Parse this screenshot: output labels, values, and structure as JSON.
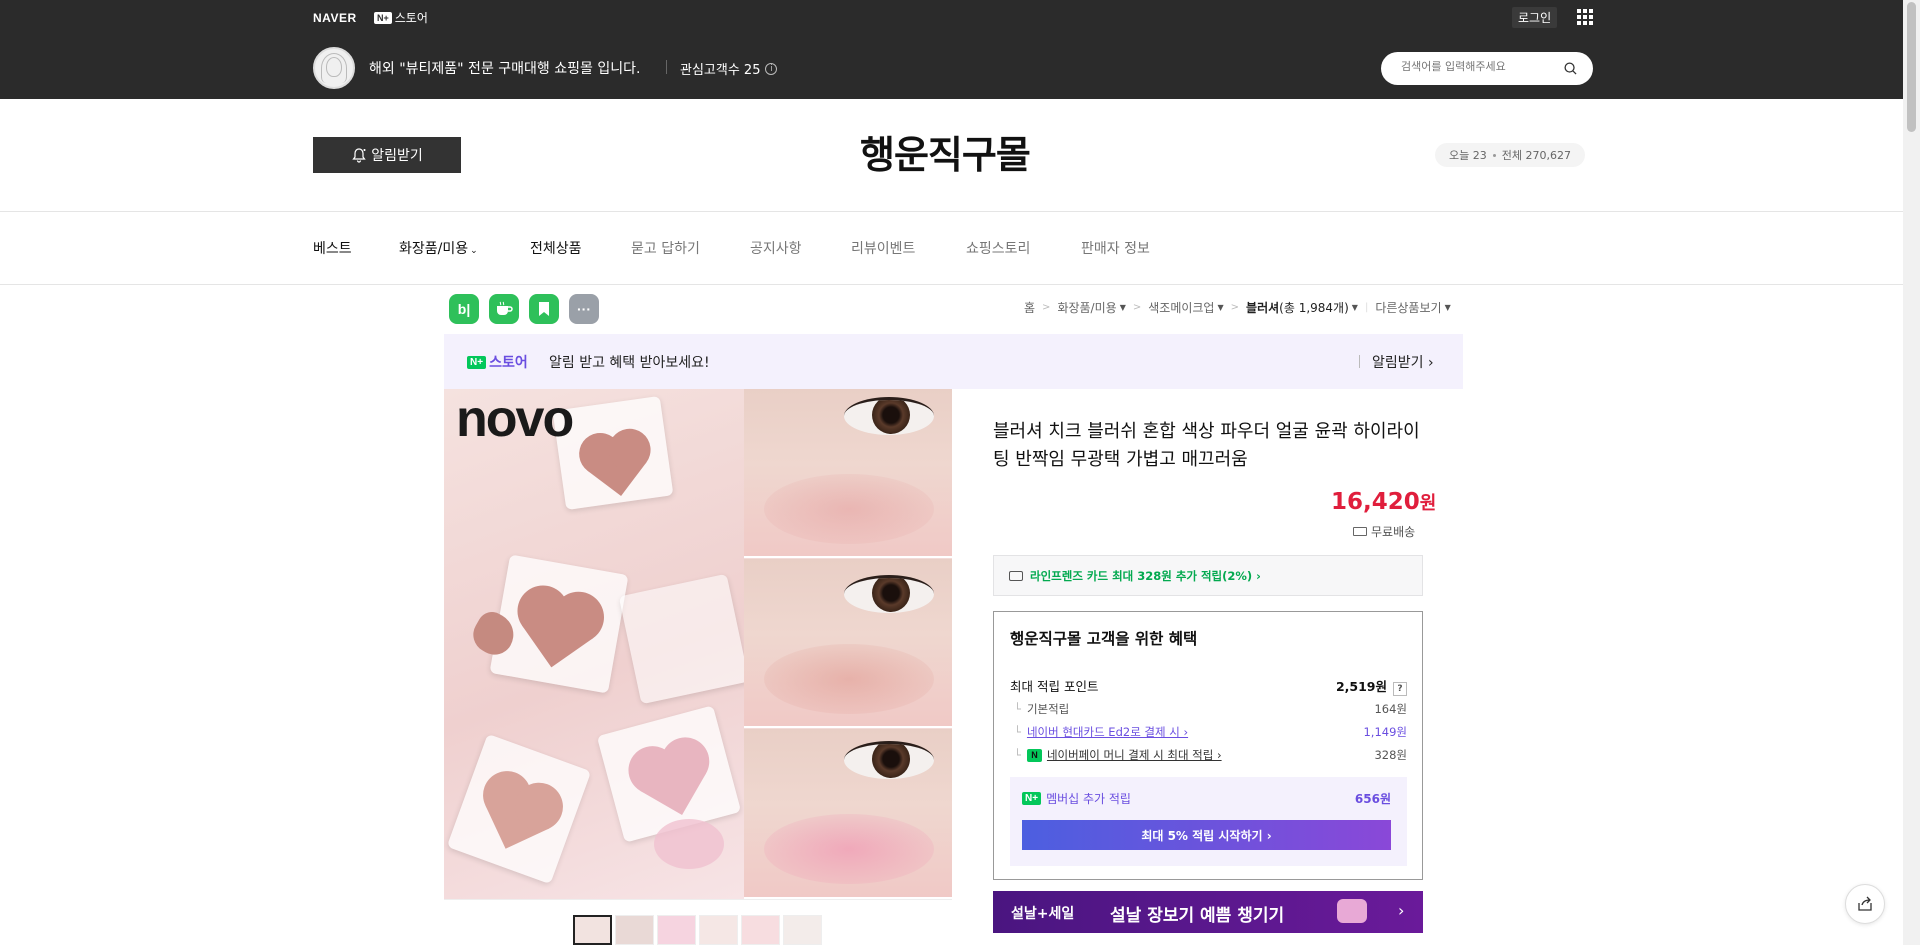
{
  "topbar": {
    "naver_logo": "NAVER",
    "store_badge": "N+",
    "store_label": "스토어",
    "login": "로그인",
    "store_description": "해외 \"뷰티제품\" 전문 구매대행 쇼핑몰 입니다.",
    "interest_label": "관심고객수 25",
    "info_glyph": "i",
    "search_placeholder": "검색어를 입력해주세요"
  },
  "header": {
    "alarm_button": "알림받기",
    "shop_name": "행운직구몰",
    "visitor_today": "오늘 23",
    "visitor_total": "전체 270,627"
  },
  "nav": [
    {
      "label": "베스트"
    },
    {
      "label": "화장품/미용"
    },
    {
      "label": "전체상품"
    },
    {
      "label": "묻고 답하기"
    },
    {
      "label": "공지사항"
    },
    {
      "label": "리뷰이벤트"
    },
    {
      "label": "쇼핑스토리"
    },
    {
      "label": "판매자 정보"
    }
  ],
  "sns": {
    "blog": "b|",
    "more": "···"
  },
  "breadcrumb": {
    "home": "홈",
    "cat1": "화장품/미용",
    "cat2": "색조메이크업",
    "cat3": "블러셔",
    "cat3_count": "(총 1,984개)",
    "other": "다른상품보기"
  },
  "notify_banner": {
    "badge": "N+",
    "store": "스토어",
    "message": "알림 받고 혜택 받아보세요!",
    "receive": "알림받기 ›"
  },
  "product_image": {
    "brand": "novo"
  },
  "product": {
    "title": "블러셔 치크 블러쉬 혼합 색상 파우더 얼굴 윤곽 하이라이팅 반짝임 무광택 가볍고 매끄러움",
    "price": "16,420",
    "price_unit": "원",
    "shipping": "무료배송",
    "card_benefit": "라인프렌즈 카드 최대 328원 추가 적립(2%) ›"
  },
  "benefit": {
    "title": "행운직구몰 고객을 위한 혜택",
    "max_points_label": "최대 적립 포인트",
    "max_points_value": "2,519원",
    "help_glyph": "?",
    "basic_label": "기본적립",
    "basic_value": "164원",
    "card_label": "네이버 현대카드 Ed2로 결제 시 ›",
    "card_value": "1,149원",
    "npay_badge": "N",
    "npay_label": "네이버페이 머니 결제 시 최대 적립 ›",
    "npay_value": "328원",
    "member_badge": "N+",
    "member_label": "멤버십 추가 적립",
    "member_value": "656원",
    "member_button": "최대 5% 적립 시작하기 ›"
  },
  "promo": {
    "tag": "설날+세일",
    "text": "설날 장보기 예쁨 챙기기",
    "arrow": "›"
  },
  "colors": {
    "topbar": "#2b2b2b",
    "naver_green": "#03c75a",
    "price_red": "#e01e3c",
    "purple": "#6a4ee0"
  }
}
